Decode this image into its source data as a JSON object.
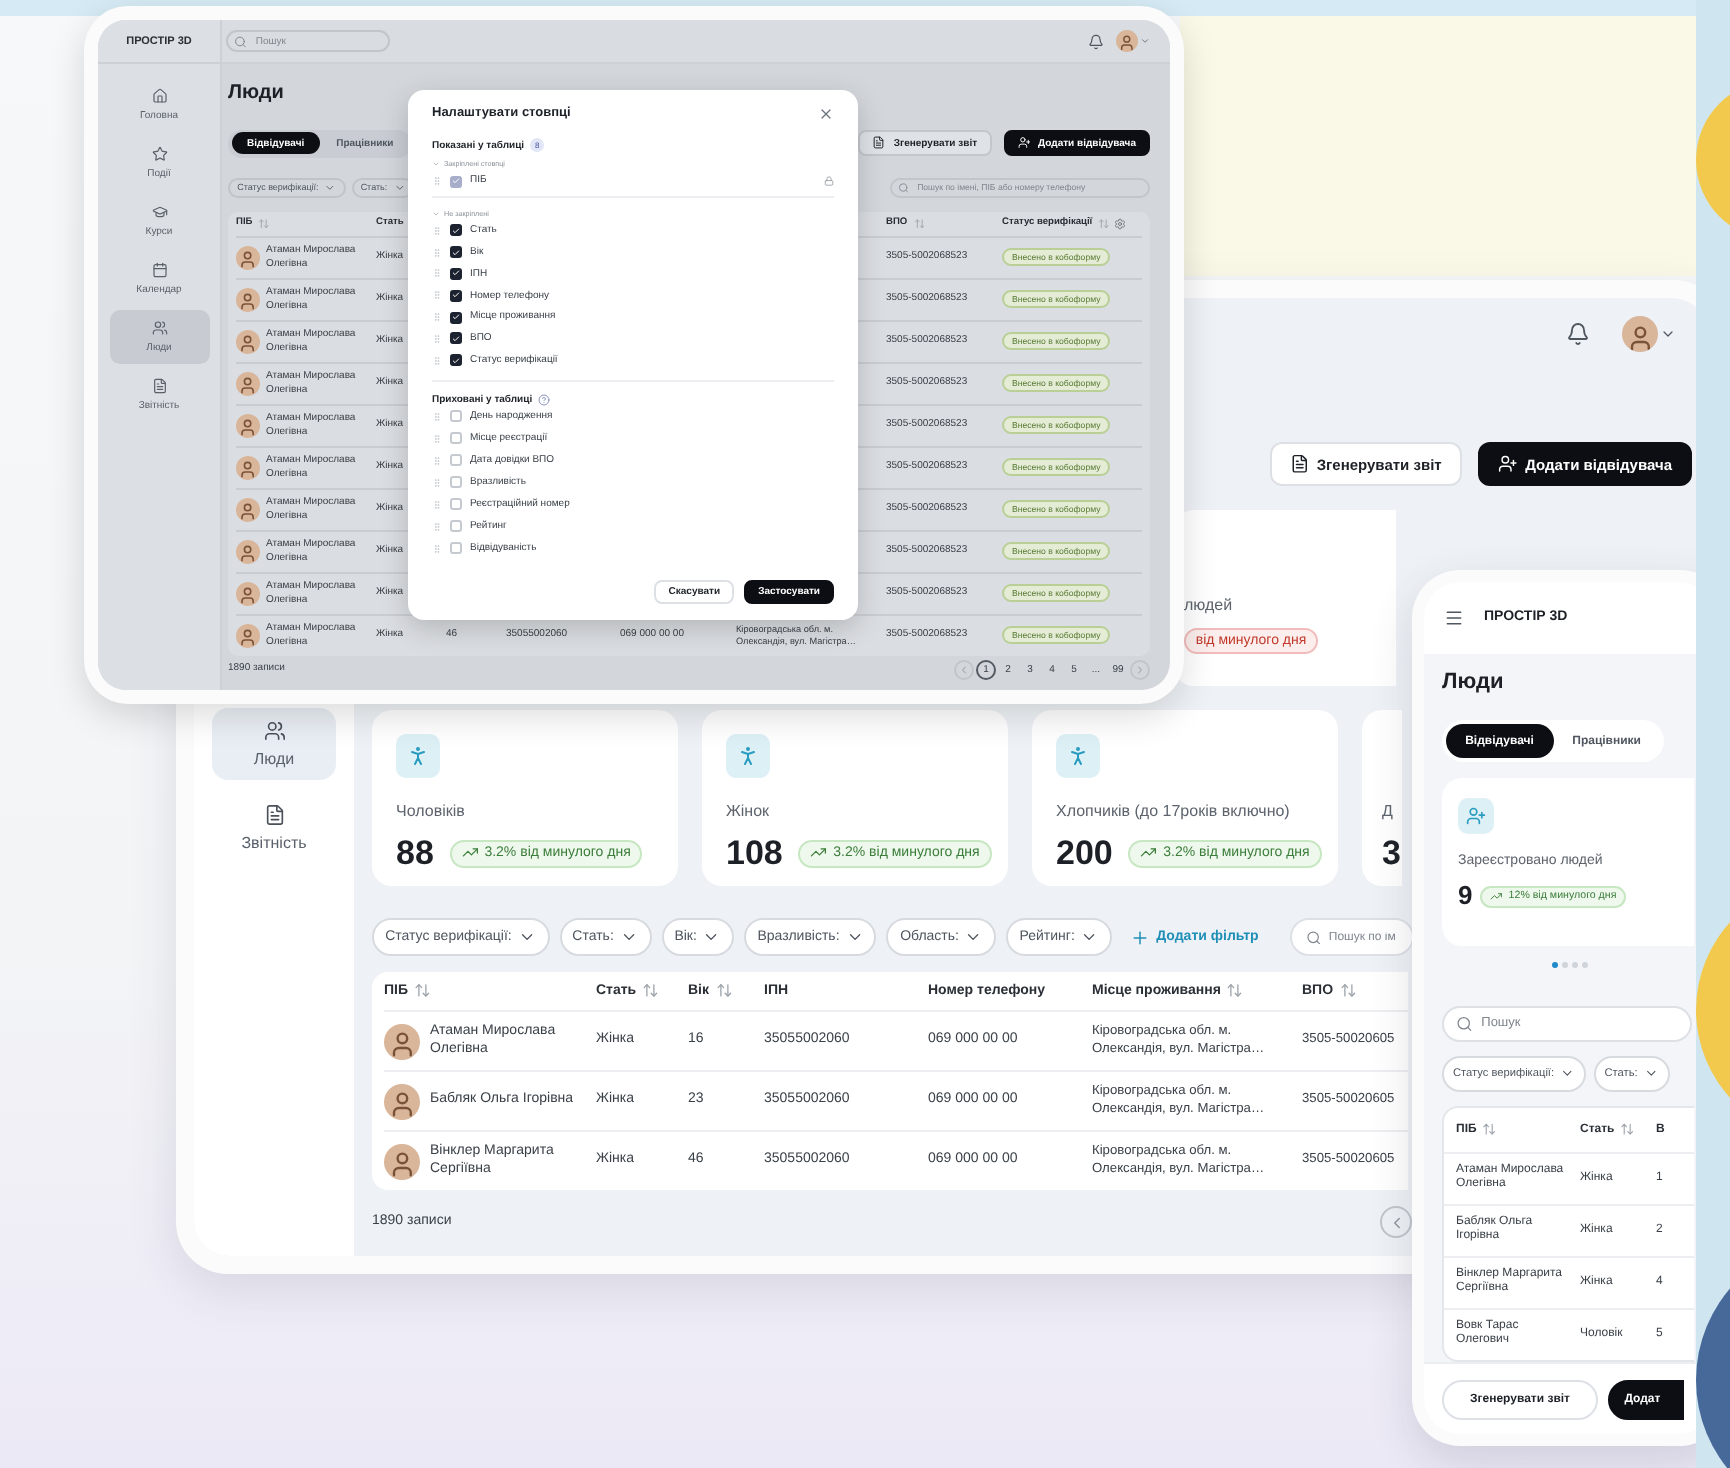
{
  "small_tablet": {
    "brand": "ПРОСТІР 3D",
    "search_placeholder": "Пошук",
    "nav": [
      {
        "label": "Головна",
        "selected": false
      },
      {
        "label": "Події",
        "selected": false
      },
      {
        "label": "Курси",
        "selected": false
      },
      {
        "label": "Календар",
        "selected": false
      },
      {
        "label": "Люди",
        "selected": true
      },
      {
        "label": "Звітність",
        "selected": false
      }
    ],
    "title": "Люди",
    "tabs": [
      {
        "label": "Відвідувачі",
        "selected": true
      },
      {
        "label": "Працівники",
        "selected": false
      }
    ],
    "actions": [
      {
        "label": "Згенерувати звіт",
        "kind": "secondary"
      },
      {
        "label": "Додати відвідувача",
        "kind": "primary"
      }
    ],
    "filters": [
      "Статус верифікації:",
      "Стать:"
    ],
    "table_search_placeholder": "Пошук по імені, ПІБ або номеру телефону",
    "columns": [
      {
        "label": "ПІБ",
        "sortable": true
      },
      {
        "label": "Стать",
        "sortable": false
      },
      {
        "label": "ВПО",
        "sortable": true
      },
      {
        "label": "Статус верифікації",
        "sortable": true
      }
    ],
    "rows": [
      {
        "name": "Атаман Мирослава Олегівна",
        "gender": "Жінка",
        "vpo": "3505-5002068523",
        "status": "Внесено в кобоформу"
      },
      {
        "name": "Атаман Мирослава Олегівна",
        "gender": "Жінка",
        "vpo": "3505-5002068523",
        "status": "Внесено в кобоформу"
      },
      {
        "name": "Атаман Мирослава Олегівна",
        "gender": "Жінка",
        "vpo": "3505-5002068523",
        "status": "Внесено в кобоформу"
      },
      {
        "name": "Атаман Мирослава Олегівна",
        "gender": "Жінка",
        "vpo": "3505-5002068523",
        "status": "Внесено в кобоформу"
      },
      {
        "name": "Атаман Мирослава Олегівна",
        "gender": "Жінка",
        "vpo": "3505-5002068523",
        "status": "Внесено в кобоформу"
      },
      {
        "name": "Атаман Мирослава Олегівна",
        "gender": "Жінка",
        "vpo": "3505-5002068523",
        "status": "Внесено в кобоформу"
      },
      {
        "name": "Атаман Мирослава Олегівна",
        "gender": "Жінка",
        "vpo": "3505-5002068523",
        "status": "Внесено в кобоформу"
      },
      {
        "name": "Атаман Мирослава Олегівна",
        "gender": "Жінка",
        "vpo": "3505-5002068523",
        "status": "Внесено в кобоформу"
      },
      {
        "name": "Атаман Мирослава Олегівна",
        "gender": "Жінка",
        "vpo": "3505-5002068523",
        "status": "Внесено в кобоформу"
      },
      {
        "name": "Атаман Мирослава Олегівна",
        "gender": "Жінка",
        "age": "46",
        "ipn": "35055002060",
        "phone": "069 000 00 00",
        "address": "Кіровоградська обл. м. Олександія, вул. Магістра…",
        "vpo": "3505-5002068523",
        "status": "Внесено в кобоформу"
      }
    ],
    "record_count": "1890 записи",
    "pages": [
      {
        "label": "1",
        "selected": true
      },
      {
        "label": "2",
        "selected": false
      },
      {
        "label": "3",
        "selected": false
      },
      {
        "label": "4",
        "selected": false
      },
      {
        "label": "5",
        "selected": false
      },
      {
        "label": "...",
        "selected": false
      },
      {
        "label": "99",
        "selected": false
      }
    ],
    "modal": {
      "title": "Налаштувати стовпці",
      "shown": {
        "label": "Показані у таблиці",
        "count": "8",
        "groups": [
          {
            "label": "Закріплені стовпці",
            "items": [
              {
                "label": "ПІБ",
                "checked": true,
                "locked": true
              }
            ]
          },
          {
            "label": "Не закріплені",
            "items": [
              {
                "label": "Стать",
                "checked": true,
                "locked": false
              },
              {
                "label": "Вік",
                "checked": true,
                "locked": false
              },
              {
                "label": "ІПН",
                "checked": true,
                "locked": false
              },
              {
                "label": "Номер телефону",
                "checked": true,
                "locked": false
              },
              {
                "label": "Місце проживання",
                "checked": true,
                "locked": false
              },
              {
                "label": "ВПО",
                "checked": true,
                "locked": false
              },
              {
                "label": "Статус верифікації",
                "checked": true,
                "locked": false
              }
            ]
          }
        ]
      },
      "hidden": {
        "label": "Приховані у таблиці",
        "items": [
          {
            "label": "День народження",
            "checked": false
          },
          {
            "label": "Місце реєстрації",
            "checked": false
          },
          {
            "label": "Дата довідки ВПО",
            "checked": false
          },
          {
            "label": "Вразливість",
            "checked": false
          },
          {
            "label": "Реєстраційний номер",
            "checked": false
          },
          {
            "label": "Рейтинг",
            "checked": false
          },
          {
            "label": "Відвідуваність",
            "checked": false
          }
        ]
      },
      "buttons": [
        {
          "label": "Скасувати",
          "kind": "secondary"
        },
        {
          "label": "Застосувати",
          "kind": "primary"
        }
      ]
    }
  },
  "large_tablet": {
    "nav": [
      {
        "label": "Люди",
        "selected": true
      },
      {
        "label": "Звітність",
        "selected": false
      }
    ],
    "actions": [
      {
        "label": "Згенерувати звіт",
        "kind": "secondary"
      },
      {
        "label": "Додати відвідувача",
        "kind": "primary"
      }
    ],
    "summary": {
      "label": "людей",
      "trend": {
        "text": "від минулого дня",
        "kind": "down"
      }
    },
    "stat_cards": [
      {
        "label": "Чоловіків",
        "value": "88",
        "trend": {
          "text": "3.2% від минулого дня",
          "kind": "up"
        }
      },
      {
        "label": "Жінок",
        "value": "108",
        "trend": {
          "text": "3.2% від минулого дня",
          "kind": "up"
        }
      },
      {
        "label": "Хлопчиків (до 17років включно)",
        "value": "200",
        "trend": {
          "text": "3.2% від минулого дня",
          "kind": "up"
        }
      },
      {
        "label": "Д",
        "value": "3"
      }
    ],
    "filters": [
      "Статус верифікації:",
      "Стать:",
      "Вік:",
      "Вразливість:",
      "Область:",
      "Рейтинг:"
    ],
    "add_filter": "Додати фільтр",
    "search_placeholder": "Пошук по ім",
    "columns": [
      {
        "label": "ПІБ",
        "sortable": true
      },
      {
        "label": "Стать",
        "sortable": true
      },
      {
        "label": "Вік",
        "sortable": true
      },
      {
        "label": "ІПН",
        "sortable": false
      },
      {
        "label": "Номер телефону",
        "sortable": false
      },
      {
        "label": "Місце проживання",
        "sortable": true
      },
      {
        "label": "ВПО",
        "sortable": true
      }
    ],
    "rows": [
      {
        "name": "Атаман Мирослава Олегівна",
        "gender": "Жінка",
        "age": "16",
        "ipn": "35055002060",
        "phone": "069 000 00 00",
        "address": "Кіровоградська обл. м. Олександія, вул. Магістра…",
        "vpo": "3505-50020605"
      },
      {
        "name": "Бабляк Ольга Ігорівна",
        "gender": "Жінка",
        "age": "23",
        "ipn": "35055002060",
        "phone": "069 000 00 00",
        "address": "Кіровоградська обл. м. Олександія, вул. Магістра…",
        "vpo": "3505-50020605"
      },
      {
        "name": "Вінклер Маргарита Сергіївна",
        "gender": "Жінка",
        "age": "46",
        "ipn": "35055002060",
        "phone": "069 000 00 00",
        "address": "Кіровоградська обл. м. Олександія, вул. Магістра…",
        "vpo": "3505-50020605"
      }
    ],
    "record_count": "1890 записи"
  },
  "phone": {
    "brand": "ПРОСТІР 3D",
    "title": "Люди",
    "tabs": [
      {
        "label": "Відвідувачі",
        "selected": true
      },
      {
        "label": "Працівники",
        "selected": false
      }
    ],
    "card": {
      "label": "Зареєстровано людей",
      "value": "9",
      "trend": {
        "text": "12% від минулого дня",
        "kind": "up"
      }
    },
    "dots": [
      {
        "selected": true
      },
      {
        "selected": false
      },
      {
        "selected": false
      },
      {
        "selected": false
      }
    ],
    "search_placeholder": "Пошук",
    "filters": [
      "Статус верифікації:",
      "Стать:"
    ],
    "columns": [
      {
        "label": "ПІБ",
        "sortable": true
      },
      {
        "label": "Стать",
        "sortable": true
      },
      {
        "label": "В",
        "sortable": false
      }
    ],
    "rows": [
      {
        "cells": [
          "Атаман Мирослава Олегівна",
          "Жінка",
          "1"
        ]
      },
      {
        "cells": [
          "Бабляк Ольга Ігорівна",
          "Жінка",
          "2"
        ]
      },
      {
        "cells": [
          "Вінклер Маргарита Сергіївна",
          "Жінка",
          "4"
        ]
      },
      {
        "cells": [
          "Вовк Тарас Олегович",
          "Чоловік",
          "5"
        ]
      }
    ],
    "buttons": [
      {
        "label": "Згенерувати звіт",
        "kind": "secondary"
      },
      {
        "label": "Додат",
        "kind": "primary"
      }
    ]
  }
}
